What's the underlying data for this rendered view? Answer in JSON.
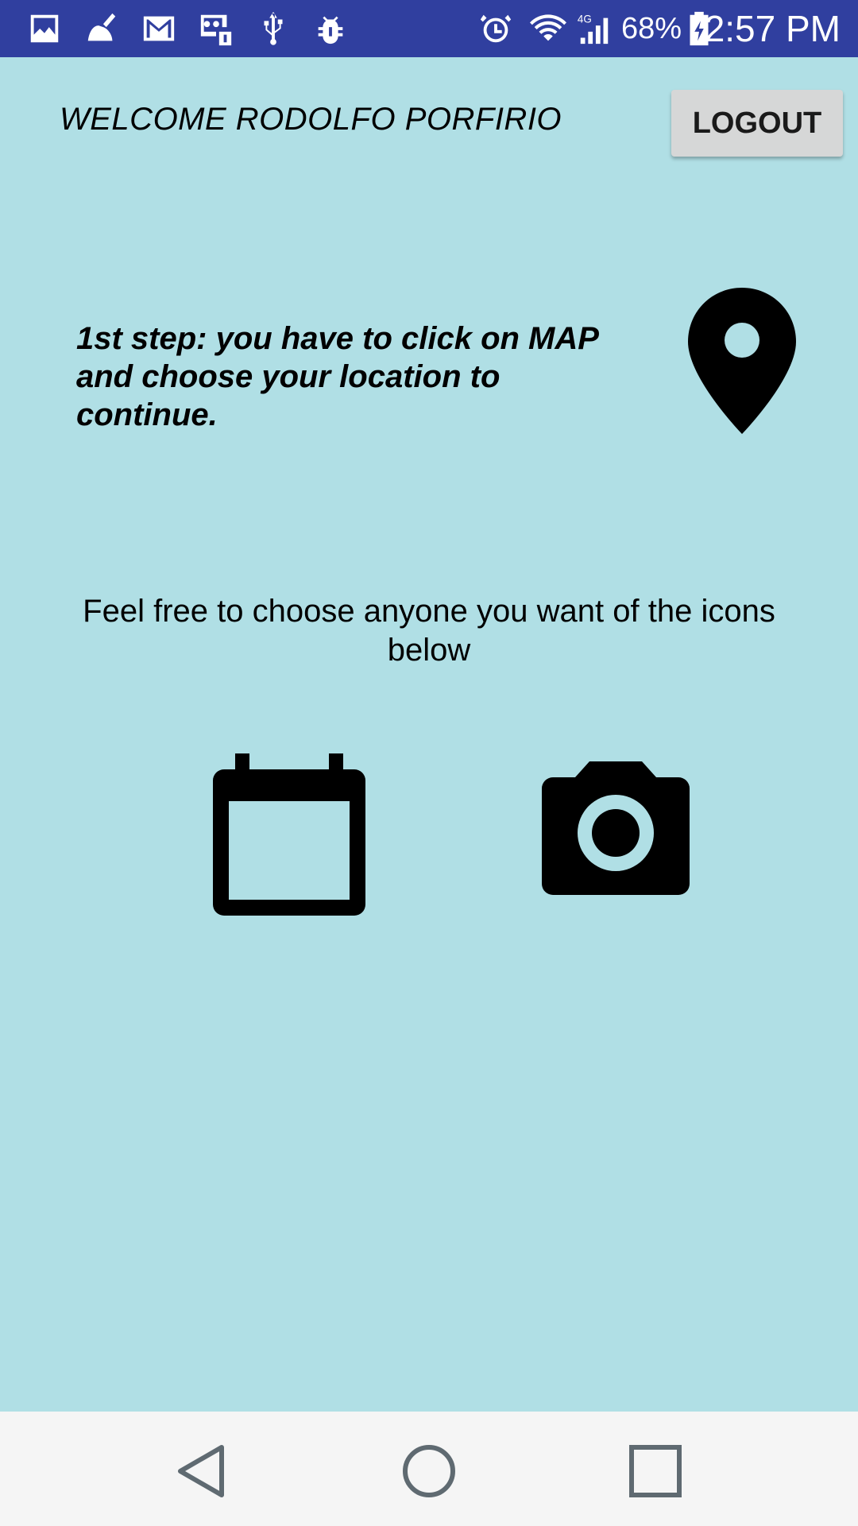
{
  "status_bar": {
    "left_icons": [
      "gallery-icon",
      "broom-icon",
      "gmail-icon",
      "voicemail-icon",
      "usb-icon",
      "bug-icon"
    ],
    "right_icons": [
      "alarm-icon",
      "wifi-icon",
      "signal-4g-icon",
      "battery-icon"
    ],
    "network_label": "4G",
    "battery_percent": "68%",
    "time": "2:57 PM",
    "background": "#303f9f"
  },
  "header": {
    "welcome_text": "WELCOME RODOLFO PORFIRIO",
    "logout_label": "LOGOUT"
  },
  "step": {
    "line1": "1st step: you have to click on MAP",
    "line2": "and choose your location to continue.",
    "map_icon": "location-pin-icon"
  },
  "choose": {
    "text": "Feel free to choose anyone you want of the icons below",
    "icons": [
      "calendar-icon",
      "camera-icon"
    ]
  },
  "nav_bar": {
    "buttons": [
      "back",
      "home",
      "recents"
    ]
  },
  "colors": {
    "background": "#b0dfe5",
    "button": "#d6d7d7",
    "nav_background": "#f5f5f5"
  }
}
